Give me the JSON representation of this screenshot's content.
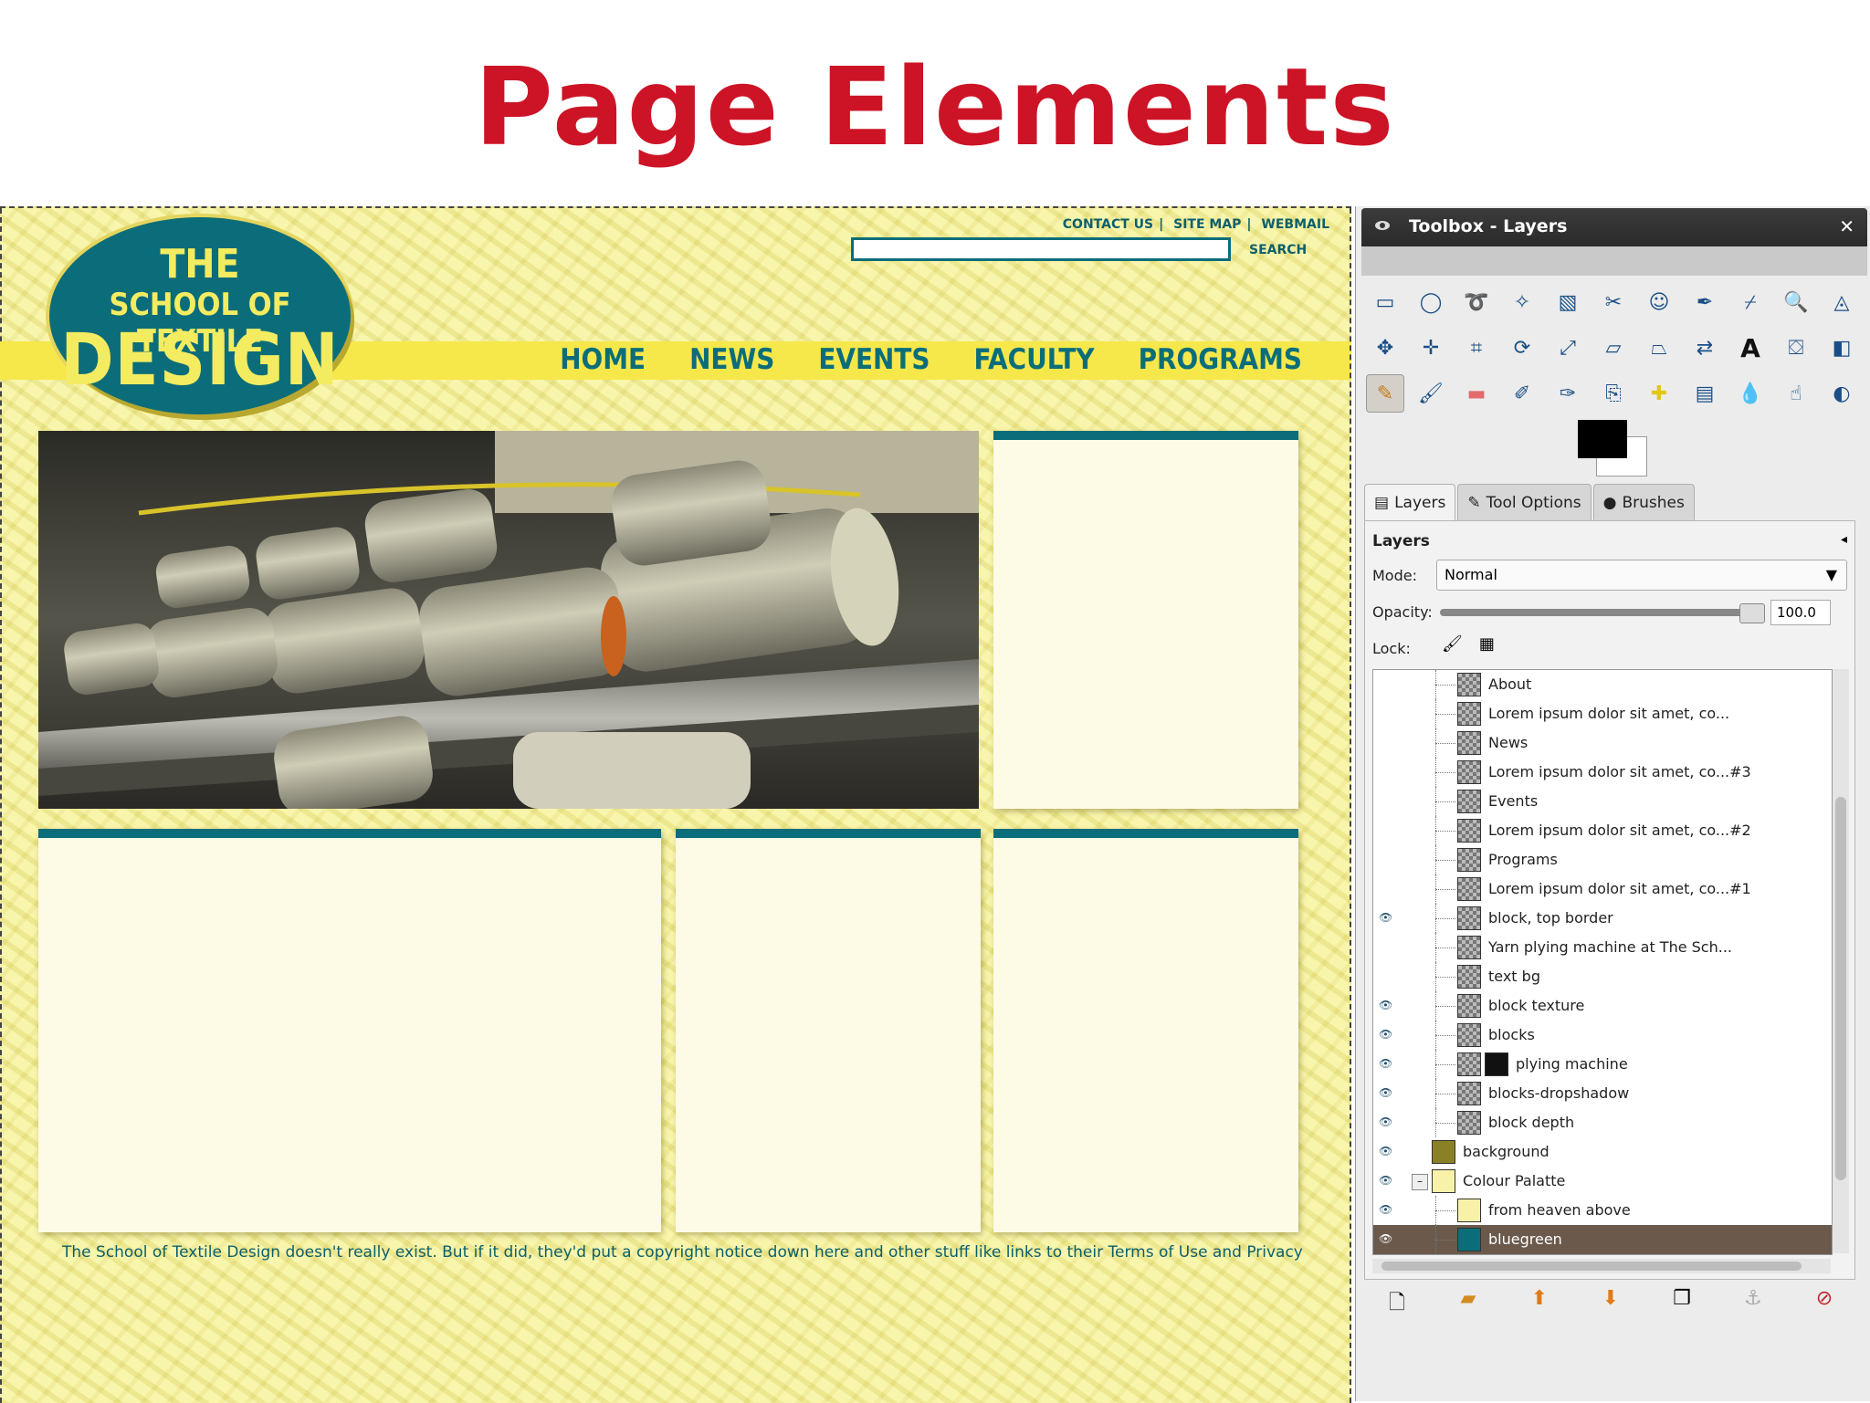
{
  "slide": {
    "title": "Page Elements"
  },
  "site": {
    "logo": {
      "line1": "THE",
      "line2": "SCHOOL OF TEXTILE",
      "line3": "DESIGN"
    },
    "top_links": [
      "CONTACT US",
      "SITE MAP",
      "WEBMAIL"
    ],
    "search_label": "SEARCH",
    "nav": [
      "HOME",
      "NEWS",
      "EVENTS",
      "FACULTY",
      "PROGRAMS"
    ],
    "footer": "The School of Textile Design doesn't really exist. But if it did, they'd put a copyright notice down here and other stuff like links to their Terms of Use and Privacy",
    "colors": {
      "teal": "#0c6d7a",
      "yellow": "#f5f09a",
      "nav_band": "#f6e84a",
      "title_red": "#cc1426"
    }
  },
  "dock": {
    "title": "Toolbox - Layers",
    "tools": [
      "rect-select-icon",
      "ellipse-select-icon",
      "free-select-icon",
      "fuzzy-select-icon",
      "color-select-icon",
      "scissors-icon",
      "foreground-select-icon",
      "paths-icon",
      "color-picker-icon",
      "zoom-icon",
      "measure-icon",
      "move-icon",
      "align-icon",
      "crop-icon",
      "rotate-icon",
      "scale-icon",
      "shear-icon",
      "perspective-icon",
      "flip-icon",
      "text-icon",
      "bucket-fill-icon",
      "blend-icon",
      "pencil-icon",
      "paintbrush-icon",
      "eraser-icon",
      "airbrush-icon",
      "ink-icon",
      "clone-icon",
      "heal-icon",
      "perspective-clone-icon",
      "blur-icon",
      "smudge-icon",
      "dodge-burn-icon"
    ],
    "tabs": [
      "Layers",
      "Tool Options",
      "Brushes"
    ],
    "panel": {
      "title": "Layers",
      "mode_label": "Mode:",
      "mode_value": "Normal",
      "opacity_label": "Opacity:",
      "opacity_value": "100.0",
      "lock_label": "Lock:",
      "layers": [
        {
          "name": "About",
          "visible": false,
          "indent": 2
        },
        {
          "name": "Lorem ipsum dolor sit amet, co...",
          "visible": false,
          "indent": 2
        },
        {
          "name": "News",
          "visible": false,
          "indent": 2
        },
        {
          "name": "Lorem ipsum dolor sit amet, co...#3",
          "visible": false,
          "indent": 2
        },
        {
          "name": "Events",
          "visible": false,
          "indent": 2
        },
        {
          "name": "Lorem ipsum dolor sit amet, co...#2",
          "visible": false,
          "indent": 2
        },
        {
          "name": "Programs",
          "visible": false,
          "indent": 2
        },
        {
          "name": "Lorem ipsum dolor sit amet, co...#1",
          "visible": false,
          "indent": 2
        },
        {
          "name": "block, top border",
          "visible": true,
          "indent": 2
        },
        {
          "name": "Yarn plying machine at The Sch...",
          "visible": false,
          "indent": 2
        },
        {
          "name": "text bg",
          "visible": false,
          "indent": 2
        },
        {
          "name": "block texture",
          "visible": true,
          "indent": 2
        },
        {
          "name": "blocks",
          "visible": true,
          "indent": 2
        },
        {
          "name": "plying machine",
          "visible": true,
          "indent": 2,
          "mask": true
        },
        {
          "name": "blocks-dropshadow",
          "visible": true,
          "indent": 2
        },
        {
          "name": "block depth",
          "visible": true,
          "indent": 2
        },
        {
          "name": "background",
          "visible": true,
          "indent": 1
        },
        {
          "name": "Colour Palatte",
          "visible": true,
          "indent": 1,
          "group": true
        },
        {
          "name": "from heaven above",
          "visible": true,
          "indent": 2
        },
        {
          "name": "bluegreen",
          "visible": true,
          "indent": 2,
          "selected": true
        }
      ]
    }
  }
}
